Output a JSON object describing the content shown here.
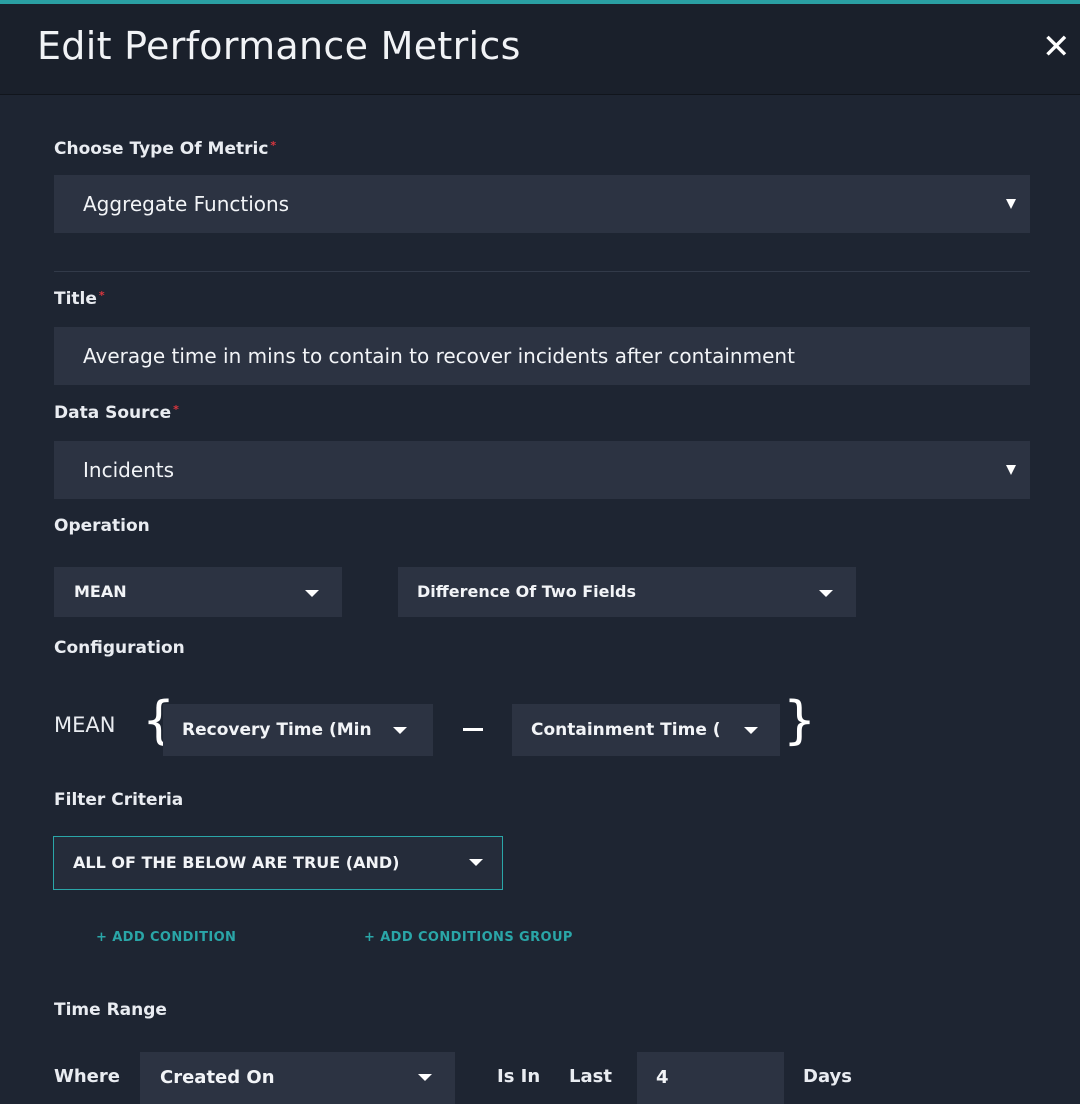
{
  "header": {
    "title": "Edit Performance Metrics",
    "close_glyph": "✕"
  },
  "metric_type": {
    "label": "Choose Type Of Metric",
    "required_mark": "*",
    "value": "Aggregate Functions"
  },
  "title_field": {
    "label": "Title",
    "required_mark": "*",
    "value": "Average time in mins to contain to recover incidents after containment"
  },
  "data_source": {
    "label": "Data Source",
    "required_mark": "*",
    "value": "Incidents"
  },
  "operation": {
    "label": "Operation",
    "function_value": "MEAN",
    "mode_value": "Difference Of Two Fields"
  },
  "configuration": {
    "label": "Configuration",
    "function_label": "MEAN",
    "left_field": "Recovery Time (Min",
    "right_field": "Containment Time (",
    "open_brace": "{",
    "close_brace": "}"
  },
  "filter": {
    "label": "Filter Criteria",
    "logic_value": "ALL OF THE BELOW ARE TRUE (AND)",
    "add_condition": "+ ADD CONDITION",
    "add_group": "+ ADD CONDITIONS GROUP"
  },
  "time_range": {
    "label": "Time Range",
    "where_label": "Where",
    "field_value": "Created On",
    "is_in_label": "Is In",
    "last_label": "Last",
    "amount_value": "4",
    "unit_label": "Days"
  },
  "colors": {
    "accent": "#2aa6a8",
    "required": "#d9363e",
    "background": "#1e2532",
    "field": "#2c3342"
  }
}
